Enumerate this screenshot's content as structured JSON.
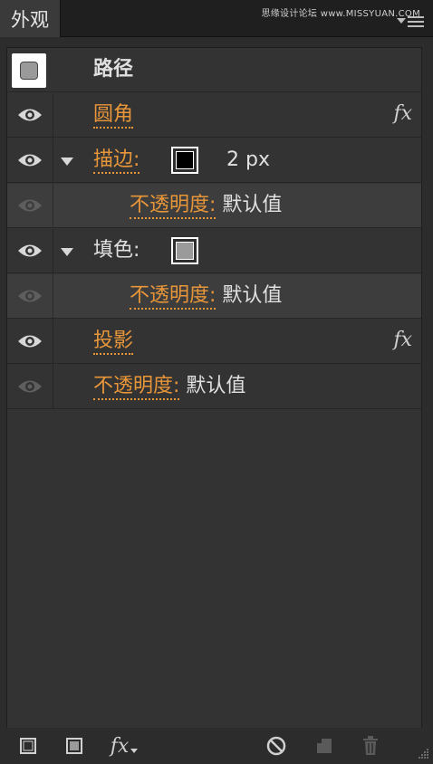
{
  "title_bar": {
    "tab_label": "外观",
    "watermark": "思缘设计论坛 www.MISSYUAN.COM"
  },
  "rows": [
    {
      "kind": "object",
      "label": "路径"
    },
    {
      "kind": "effect",
      "label": "圆角",
      "fx": "fx"
    },
    {
      "kind": "stroke",
      "label": "描边:",
      "value": "2 px"
    },
    {
      "kind": "opacity",
      "label": "不透明度:",
      "value": "默认值"
    },
    {
      "kind": "fill",
      "label": "填色:"
    },
    {
      "kind": "opacity",
      "label": "不透明度:",
      "value": "默认值"
    },
    {
      "kind": "effect",
      "label": "投影",
      "fx": "fx"
    },
    {
      "kind": "opacity",
      "label": "不透明度:",
      "value": "默认值"
    }
  ],
  "toolbar": {
    "fx_label": "fx"
  },
  "colors": {
    "accent_orange": "#e8963a",
    "panel_bg": "#333333",
    "sub_row_bg": "#3d3d3d",
    "stroke_swatch": "#000000",
    "fill_swatch": "#9a9a9a"
  },
  "icons": {
    "visibility": "eye-icon",
    "disclosure": "triangle-down-icon",
    "effects": "fx-icon",
    "clear": "no-symbol-icon",
    "duplicate": "duplicate-icon",
    "delete": "trash-icon",
    "panel_menu": "hamburger-icon"
  }
}
